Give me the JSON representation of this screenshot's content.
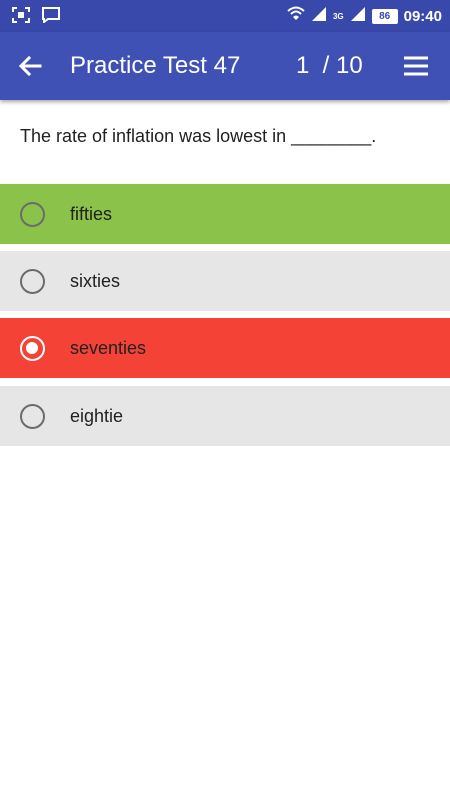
{
  "status_bar": {
    "time": "09:40",
    "battery": "86",
    "network_label": "3G",
    "icons": [
      "screenshot-icon",
      "chat-icon",
      "wifi-icon",
      "signal-icon",
      "signal-icon",
      "battery-icon"
    ]
  },
  "app_bar": {
    "title": "Practice Test 47",
    "counter": "1  / 10",
    "color": "#3f51b5",
    "back_icon": "arrow-back-icon",
    "menu_icon": "menu-icon"
  },
  "question": {
    "text": "The rate of inflation was lowest in ________."
  },
  "options": [
    {
      "label": "fifties",
      "state": "correct",
      "selected": false,
      "color": "#8bc34a"
    },
    {
      "label": "sixties",
      "state": "neutral",
      "selected": false,
      "color": "#e6e6e6"
    },
    {
      "label": "seventies",
      "state": "wrong",
      "selected": true,
      "color": "#f44336"
    },
    {
      "label": "eightie",
      "state": "neutral",
      "selected": false,
      "color": "#e6e6e6"
    }
  ]
}
